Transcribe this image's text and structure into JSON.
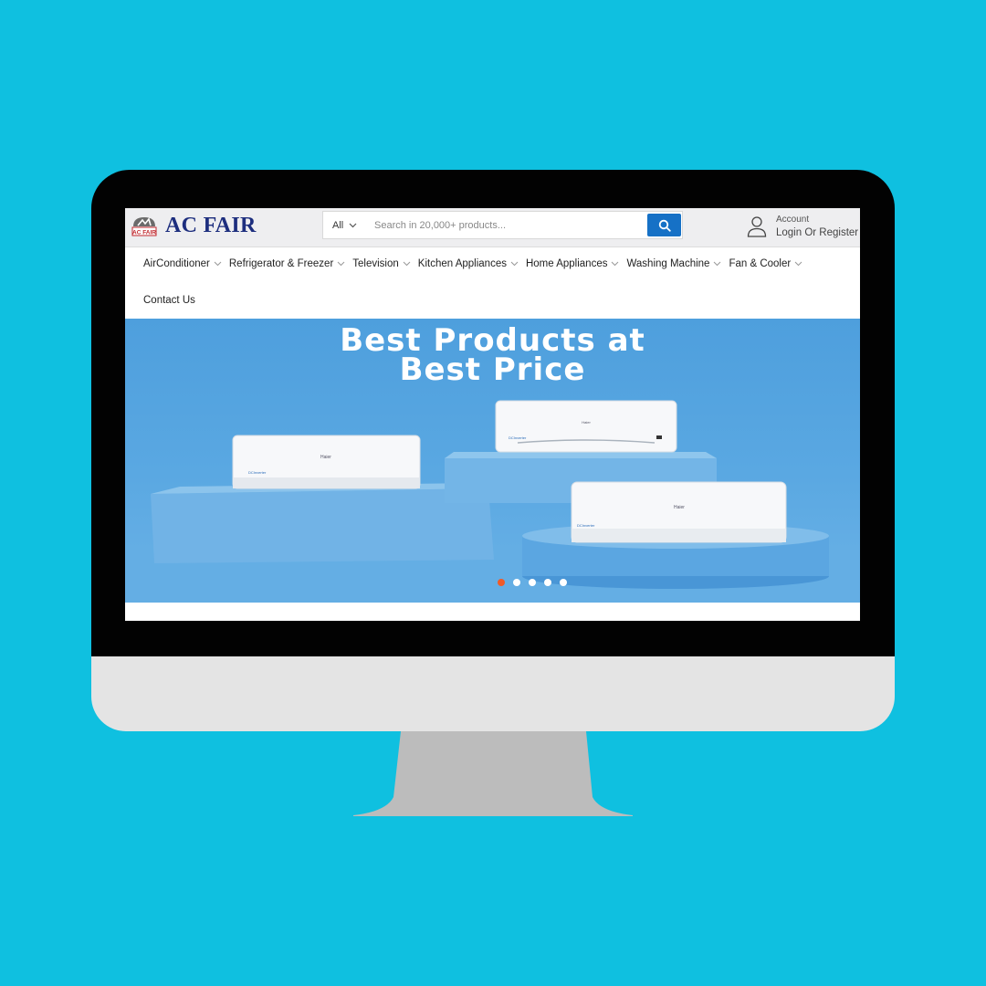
{
  "logo": {
    "text": "AC FAIR",
    "mark_text": "AC FAIR"
  },
  "search": {
    "category": "All",
    "placeholder": "Search in 20,000+ products...",
    "button_icon": "search-icon"
  },
  "account": {
    "label": "Account",
    "link": "Login Or Register",
    "icon": "user-icon"
  },
  "nav": {
    "items": [
      {
        "label": "AirConditioner"
      },
      {
        "label": "Refrigerator & Freezer"
      },
      {
        "label": "Television"
      },
      {
        "label": "Kitchen Appliances"
      },
      {
        "label": "Home Appliances"
      },
      {
        "label": "Washing Machine"
      },
      {
        "label": "Fan & Cooler"
      }
    ],
    "contact": "Contact Us"
  },
  "hero": {
    "title_line1": "Best Products at",
    "title_line2": "Best Price",
    "brand": "Haier",
    "badge": "DCInverter",
    "slides": 5,
    "active_slide": 1
  },
  "colors": {
    "background": "#0fc0e0",
    "brand_blue": "#1d2e7e",
    "search_button": "#1671c6",
    "active_dot": "#f05a28",
    "hero_blue": "#5aa8e2"
  }
}
